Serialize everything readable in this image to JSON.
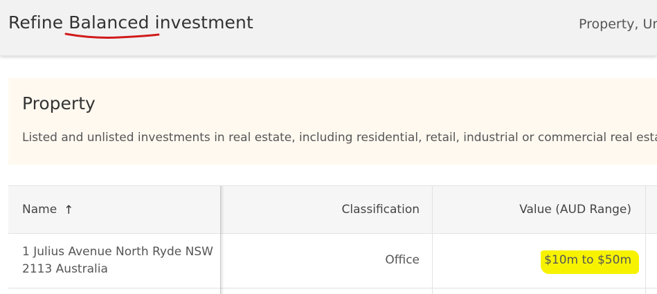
{
  "header": {
    "title_prefix": "Refine ",
    "title_highlight": "Balanced",
    "title_suffix": " investment",
    "right_text": "Property, Ur"
  },
  "info": {
    "title": "Property",
    "description": "Listed and unlisted investments in real estate, including residential, retail, industrial or commercial real estate."
  },
  "table": {
    "columns": {
      "name": "Name",
      "name_sort_icon": "↑",
      "classification": "Classification",
      "value": "Value (AUD Range)"
    },
    "rows": [
      {
        "name": "1 Julius Avenue North Ryde NSW 2113 Australia",
        "classification": "Office",
        "value": "$10m to $50m"
      }
    ]
  },
  "icons": {
    "sort": "arrow-up-icon"
  },
  "colors": {
    "header_bg": "#f2f2f3",
    "info_bg": "#fff9f0",
    "underline_annotation": "#d11a1a",
    "highlight_annotation": "#f7f300"
  }
}
